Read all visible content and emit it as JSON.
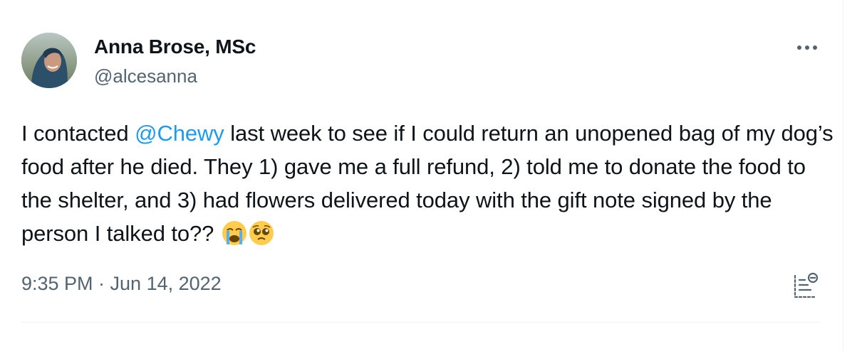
{
  "author": {
    "display_name": "Anna Brose, MSc",
    "handle": "@alcesanna"
  },
  "tweet": {
    "text_before_mention": "I contacted ",
    "mention": "@Chewy",
    "text_after_mention": " last week to see if I could return an unopened bag of my dog’s food after he died. They 1) gave me a full refund, 2) told me to donate the food to the shelter, and 3) had flowers delivered today with the gift note signed by the person I talked to?? ",
    "emojis": [
      "crying-face",
      "pleading-face"
    ],
    "timestamp": "9:35 PM · Jun 14, 2022"
  },
  "icons": {
    "more": "more-options-icon",
    "translate": "post-analytics-icon"
  },
  "colors": {
    "text": "#0f1419",
    "secondary": "#536471",
    "link": "#1d9bf0",
    "divider": "#eff3f4"
  }
}
